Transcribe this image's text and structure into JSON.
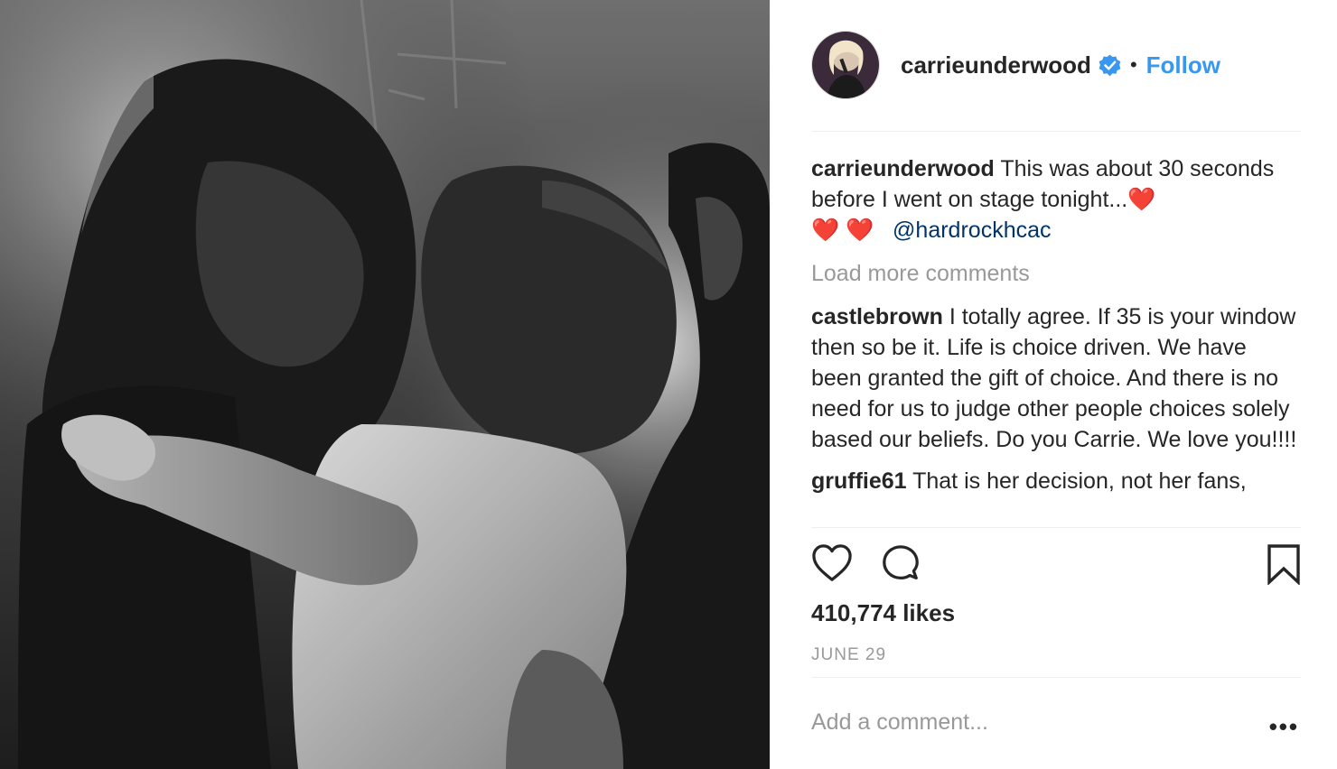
{
  "header": {
    "username": "carrieunderwood",
    "dot": "•",
    "follow_label": "Follow"
  },
  "caption": {
    "username": "carrieunderwood",
    "text": "This was about 30 seconds before I went on stage tonight...",
    "emoji": "❤️",
    "emoji_line2": "❤️ ❤️",
    "mention": "@hardrockhcac"
  },
  "load_more_label": "Load more comments",
  "comments": [
    {
      "username": "castlebrown",
      "text": "I totally agree. If 35 is your window then so be it. Life is choice driven. We have been granted the gift of choice. And there is no need for us to judge other people choices solely based our beliefs. Do you Carrie. We love you!!!!"
    },
    {
      "username": "gruffie61",
      "text": "That is her decision, not her fans,"
    }
  ],
  "likes_label": "410,774 likes",
  "date_label": "JUNE 29",
  "add_comment_placeholder": "Add a comment...",
  "more_label": "•••",
  "colors": {
    "link": "#3897f0",
    "mention": "#003569",
    "muted": "#999999",
    "text": "#262626",
    "heart": "#e0245e"
  },
  "icons": [
    "heart-icon",
    "comment-icon",
    "bookmark-icon",
    "verified-icon",
    "more-icon"
  ]
}
